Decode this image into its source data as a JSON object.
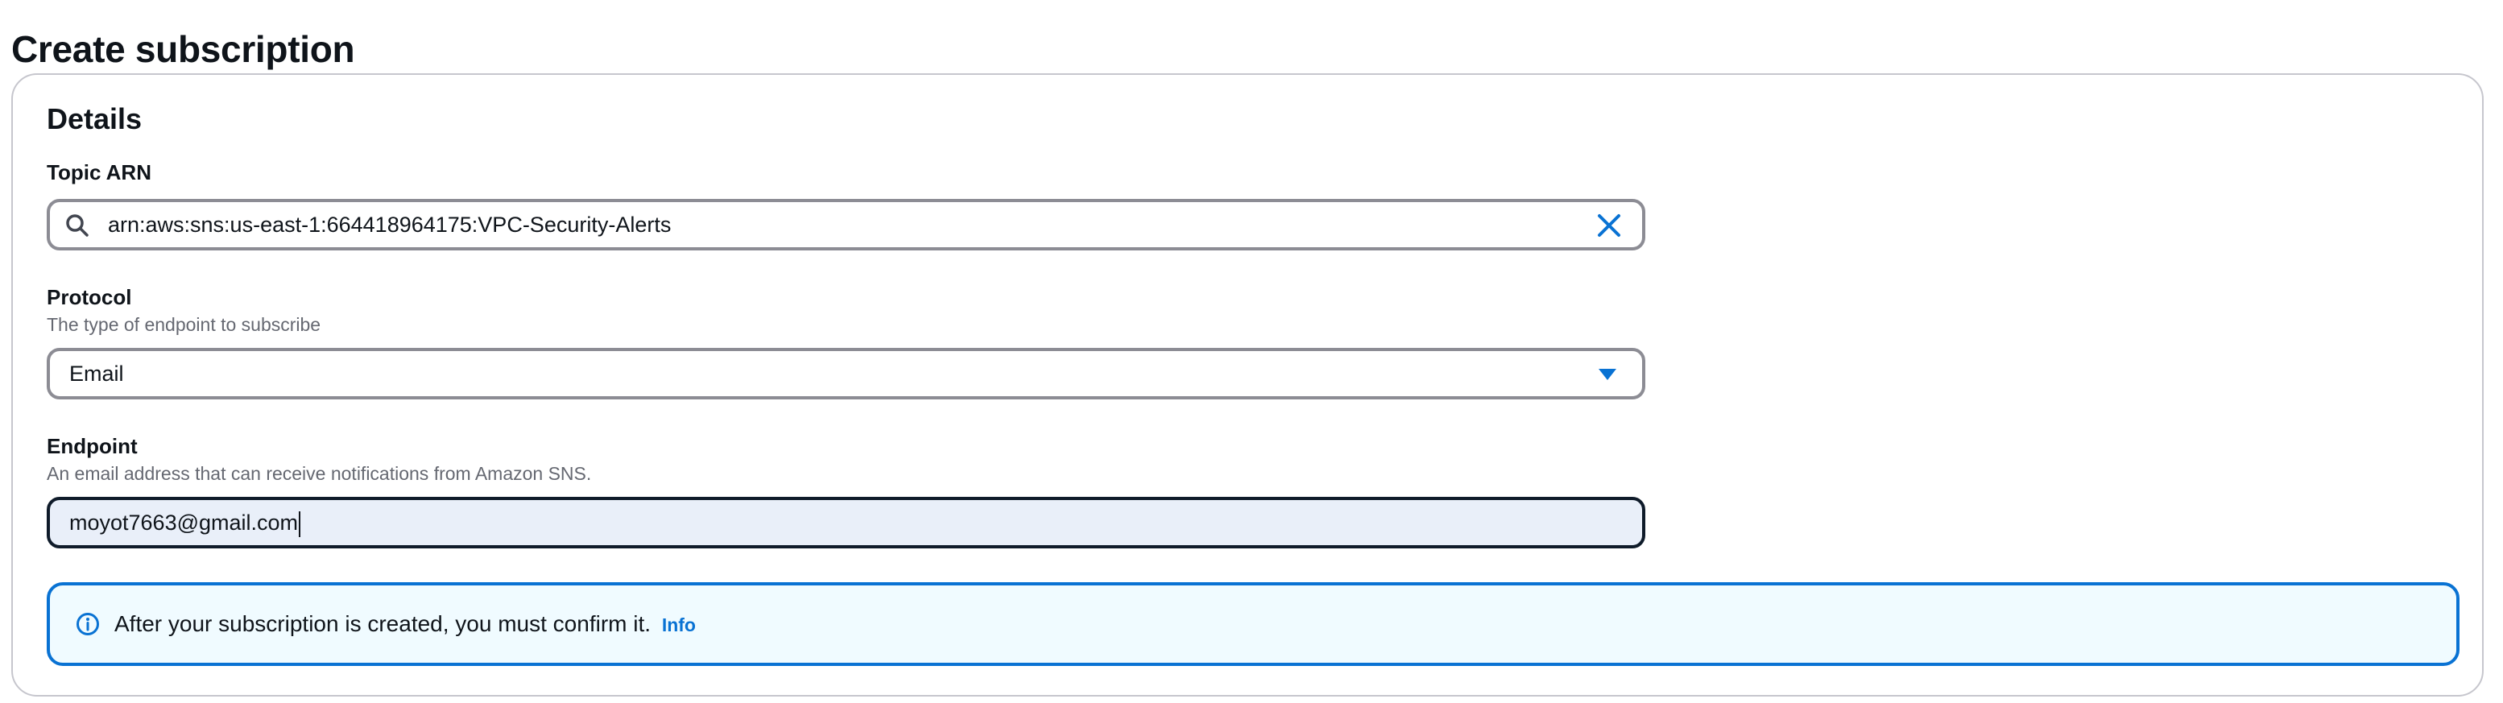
{
  "page": {
    "title": "Create subscription"
  },
  "details": {
    "title": "Details",
    "topic_arn": {
      "label": "Topic ARN",
      "value": "arn:aws:sns:us-east-1:664418964175:VPC-Security-Alerts",
      "search_icon": "search-icon",
      "clear_icon": "close-icon"
    },
    "protocol": {
      "label": "Protocol",
      "description": "The type of endpoint to subscribe",
      "selected": "Email",
      "dropdown_icon": "caret-down-icon"
    },
    "endpoint": {
      "label": "Endpoint",
      "description": "An email address that can receive notifications from Amazon SNS.",
      "value": "moyot7663@gmail.com"
    },
    "alert": {
      "icon": "info-icon",
      "message": "After your subscription is created, you must confirm it.",
      "link": "Info"
    }
  },
  "colors": {
    "accent": "#0972d3",
    "alert_background": "#f0fbff",
    "focused_input_background": "#e9eff9",
    "panel_border": "#c6c6cd"
  }
}
